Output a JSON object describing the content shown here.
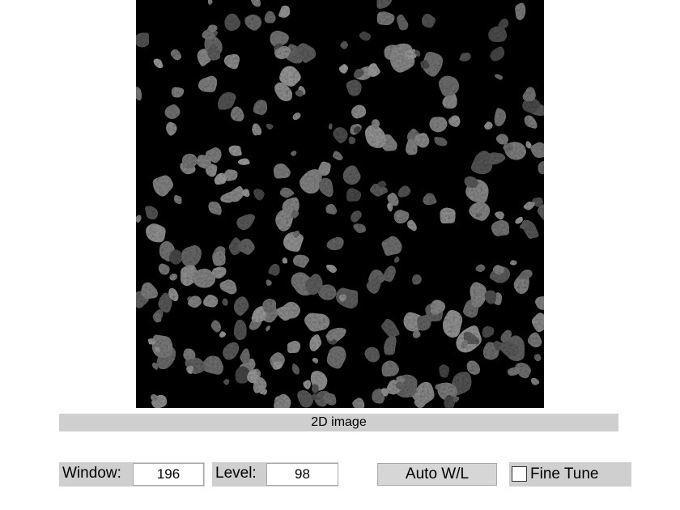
{
  "image": {
    "caption": "2D image",
    "content": "grayscale fluorescence microscopy of cell nuclei on black background"
  },
  "controls": {
    "window_label": "Window:",
    "window_value": "196",
    "level_label": "Level:",
    "level_value": "98",
    "auto_button_label": "Auto W/L",
    "fine_tune_label": "Fine Tune",
    "fine_tune_checked": false
  },
  "colors": {
    "panel_gray": "#cfcfcf",
    "image_background": "#000000"
  }
}
